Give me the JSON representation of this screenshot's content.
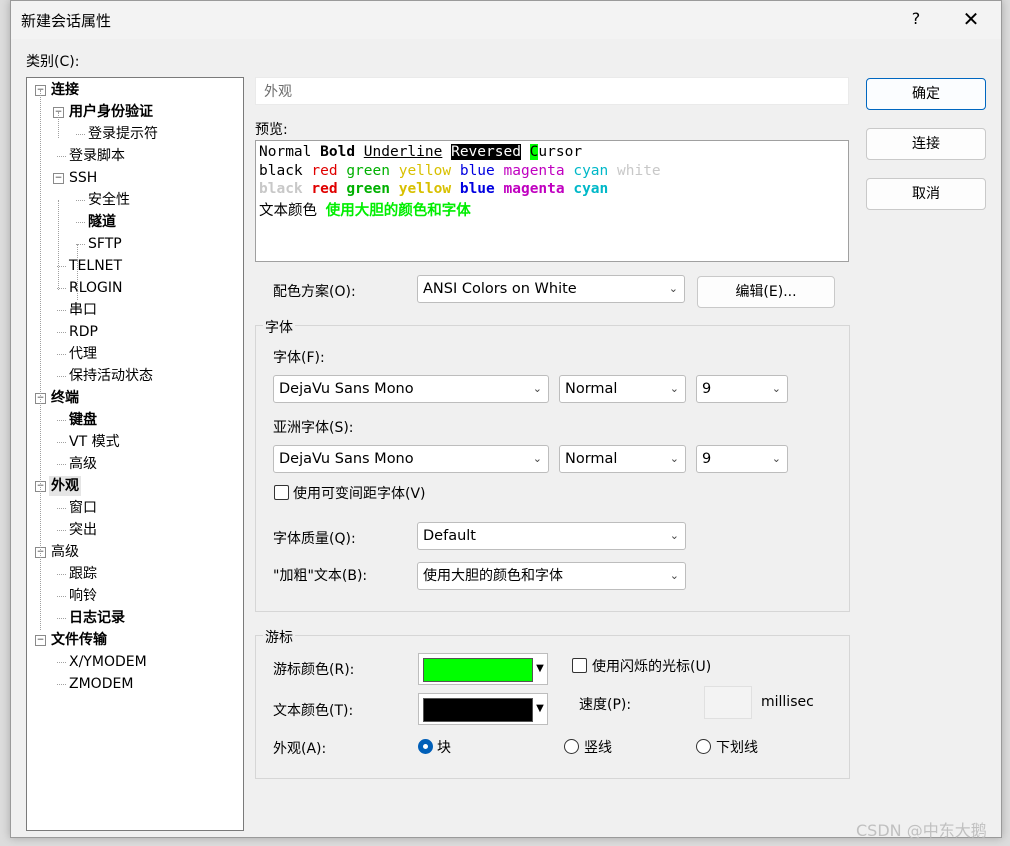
{
  "window": {
    "title": "新建会话属性",
    "help": "?",
    "close": "✕"
  },
  "category_label": "类别(C):",
  "tree": [
    {
      "label": "连接",
      "bold": true,
      "level": 0,
      "expander": "−"
    },
    {
      "label": "用户身份验证",
      "bold": true,
      "level": 1,
      "expander": "−"
    },
    {
      "label": "登录提示符",
      "bold": false,
      "level": 2
    },
    {
      "label": "登录脚本",
      "bold": false,
      "level": 1
    },
    {
      "label": "SSH",
      "bold": false,
      "level": 1,
      "expander": "−"
    },
    {
      "label": "安全性",
      "bold": false,
      "level": 2
    },
    {
      "label": "隧道",
      "bold": true,
      "level": 2
    },
    {
      "label": "SFTP",
      "bold": false,
      "level": 2
    },
    {
      "label": "TELNET",
      "bold": false,
      "level": 1
    },
    {
      "label": "RLOGIN",
      "bold": false,
      "level": 1
    },
    {
      "label": "串口",
      "bold": false,
      "level": 1
    },
    {
      "label": "RDP",
      "bold": false,
      "level": 1
    },
    {
      "label": "代理",
      "bold": false,
      "level": 1
    },
    {
      "label": "保持活动状态",
      "bold": false,
      "level": 1
    },
    {
      "label": "终端",
      "bold": true,
      "level": 0,
      "expander": "−"
    },
    {
      "label": "键盘",
      "bold": true,
      "level": 1
    },
    {
      "label": "VT 模式",
      "bold": false,
      "level": 1
    },
    {
      "label": "高级",
      "bold": false,
      "level": 1
    },
    {
      "label": "外观",
      "bold": true,
      "level": 0,
      "expander": "−",
      "selected": true
    },
    {
      "label": "窗口",
      "bold": false,
      "level": 1
    },
    {
      "label": "突出",
      "bold": false,
      "level": 1
    },
    {
      "label": "高级",
      "bold": false,
      "level": 0,
      "expander": "−"
    },
    {
      "label": "跟踪",
      "bold": false,
      "level": 1
    },
    {
      "label": "响铃",
      "bold": false,
      "level": 1
    },
    {
      "label": "日志记录",
      "bold": true,
      "level": 1
    },
    {
      "label": "文件传输",
      "bold": true,
      "level": 0,
      "expander": "−"
    },
    {
      "label": "X/YMODEM",
      "bold": false,
      "level": 1
    },
    {
      "label": "ZMODEM",
      "bold": false,
      "level": 1
    }
  ],
  "buttons": {
    "ok": "确定",
    "connect": "连接",
    "cancel": "取消",
    "edit": "编辑(E)..."
  },
  "page_title": "外观",
  "preview": {
    "label": "预览:",
    "line1": {
      "normal": "Normal",
      "bold": "Bold",
      "underline": "Underline",
      "reversed": "Reversed",
      "cursor_char": "C",
      "cursor_rest": "ursor"
    },
    "colors": {
      "black": "black",
      "red": "red",
      "green": "green",
      "yellow": "yellow",
      "blue": "blue",
      "magenta": "magenta",
      "cyan": "cyan",
      "white": "white"
    },
    "text_color_label": "文本颜色",
    "bold_sample": "使用大胆的颜色和字体"
  },
  "palette": {
    "black": "#000000",
    "red": "#e00000",
    "green": "#00b000",
    "yellow": "#d8c000",
    "blue": "#0000e0",
    "magenta": "#c000c0",
    "cyan": "#00b8c8",
    "white": "#c8c8c8",
    "bright_green": "#00ee00"
  },
  "scheme": {
    "label": "配色方案(O):",
    "value": "ANSI Colors on White"
  },
  "font_group": {
    "title": "字体",
    "font_label": "字体(F):",
    "font": "DejaVu Sans Mono",
    "weight": "Normal",
    "size": "9",
    "asian_label": "亚洲字体(S):",
    "asian_font": "DejaVu Sans Mono",
    "asian_weight": "Normal",
    "asian_size": "9",
    "variable_label": "使用可变间距字体(V)",
    "quality_label": "字体质量(Q):",
    "quality": "Default",
    "bold_label": "\"加粗\"文本(B):",
    "bold": "使用大胆的颜色和字体"
  },
  "cursor_group": {
    "title": "游标",
    "cursor_color_label": "游标颜色(R):",
    "cursor_color": "#00ff00",
    "text_color_label": "文本颜色(T):",
    "text_color": "#000000",
    "blink_label": "使用闪烁的光标(U)",
    "speed_label": "速度(P):",
    "speed_unit": "millisec",
    "appearance_label": "外观(A):",
    "opt_block": "块",
    "opt_vline": "竖线",
    "opt_underline": "下划线"
  },
  "watermark": "CSDN @中东大鹅"
}
